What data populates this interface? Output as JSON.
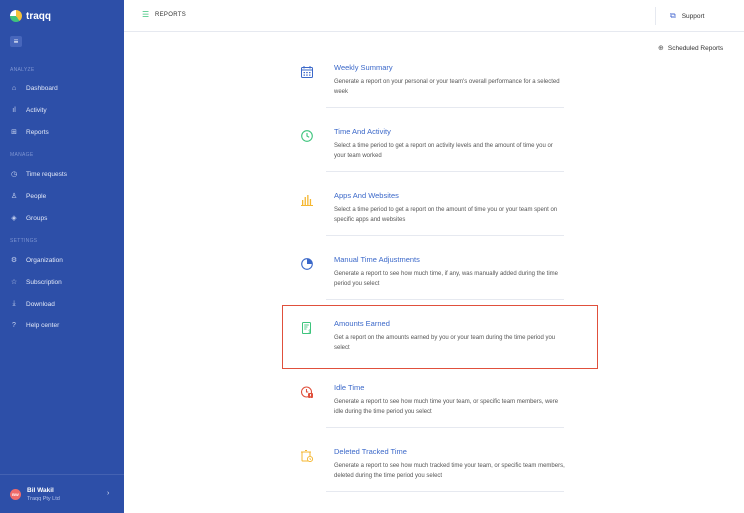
{
  "sidebar": {
    "brand": "traqq",
    "sections": [
      {
        "label": "ANALYZE"
      },
      {
        "label": "MANAGE"
      },
      {
        "label": "SETTINGS"
      }
    ],
    "items": [
      {
        "label": "Dashboard",
        "icon": "home-icon"
      },
      {
        "label": "Activity",
        "icon": "bar-chart-icon"
      },
      {
        "label": "Reports",
        "icon": "reports-icon"
      },
      {
        "label": "Time requests",
        "icon": "clock-icon"
      },
      {
        "label": "People",
        "icon": "people-icon"
      },
      {
        "label": "Groups",
        "icon": "groups-icon"
      },
      {
        "label": "Organization",
        "icon": "organization-icon"
      },
      {
        "label": "Subscription",
        "icon": "star-icon"
      },
      {
        "label": "Download",
        "icon": "download-icon"
      },
      {
        "label": "Help center",
        "icon": "help-icon"
      }
    ],
    "user": {
      "initials": "BW",
      "name": "Bil Wakil",
      "org": "Traqq Pty Ltd"
    }
  },
  "topbar": {
    "title": "REPORTS",
    "support_label": "Support"
  },
  "scheduled_label": "Scheduled Reports",
  "reports": [
    {
      "title": "Weekly Summary",
      "desc": "Generate a report on your personal or your team's overall performance for a selected week",
      "icon": "calendar-icon",
      "color": "#3b68c9"
    },
    {
      "title": "Time And Activity",
      "desc": "Select a time period to get a report on activity levels and the amount of time you or your team worked",
      "icon": "clock-icon",
      "color": "#3ec47d"
    },
    {
      "title": "Apps And Websites",
      "desc": "Select a time period to get a report on the amount of time you or your team spent on specific apps and websites",
      "icon": "bar-chart-icon",
      "color": "#f5b731"
    },
    {
      "title": "Manual Time Adjustments",
      "desc": "Generate a report to see how much time, if any, was manually added during the time period you select",
      "icon": "pie-chart-icon",
      "color": "#3b68c9"
    },
    {
      "title": "Amounts Earned",
      "desc": "Get a report on the amounts earned by you or your team during the time period you select",
      "icon": "invoice-icon",
      "color": "#3ec47d"
    },
    {
      "title": "Idle Time",
      "desc": "Generate a report to see how much time your team, or specific team members, were idle during the time period you select",
      "icon": "idle-clock-icon",
      "color": "#e0503c"
    },
    {
      "title": "Deleted Tracked Time",
      "desc": "Generate a report to see how much tracked time your team, or specific team members, deleted during the time period you select",
      "icon": "deleted-time-icon",
      "color": "#f5b731"
    }
  ]
}
